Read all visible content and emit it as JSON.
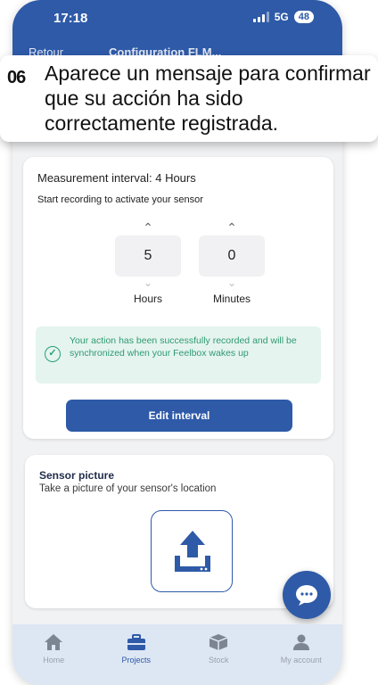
{
  "status_bar": {
    "time": "17:18",
    "network": "5G",
    "battery": "48"
  },
  "nav": {
    "back_label": "Retour",
    "title": "Configuration FLM..."
  },
  "callout": {
    "step": "06",
    "text": "Aparece un mensaje para confirmar que su acción ha sido correctamente registrada."
  },
  "interval": {
    "label": "Measurement interval: 4 Hours",
    "sublabel": "Start recording to activate your sensor",
    "hours_value": "5",
    "hours_label": "Hours",
    "minutes_value": "0",
    "minutes_label": "Minutes",
    "toast_text": "Your action has been successfully recorded and will be synchronized when your Feelbox wakes up",
    "edit_button": "Edit interval"
  },
  "sensor_picture": {
    "title": "Sensor picture",
    "subtitle": "Take a picture of your sensor's location"
  },
  "bottom_nav": [
    {
      "label": "Home",
      "icon": "home-icon",
      "active": false
    },
    {
      "label": "Projects",
      "icon": "briefcase-icon",
      "active": true
    },
    {
      "label": "Stock",
      "icon": "box-icon",
      "active": false
    },
    {
      "label": "My account",
      "icon": "user-icon",
      "active": false
    }
  ],
  "colors": {
    "primary": "#2e5aa8",
    "success": "#27a17a",
    "success_bg": "#e5f4ef",
    "nav_bg": "#dde6f3"
  }
}
